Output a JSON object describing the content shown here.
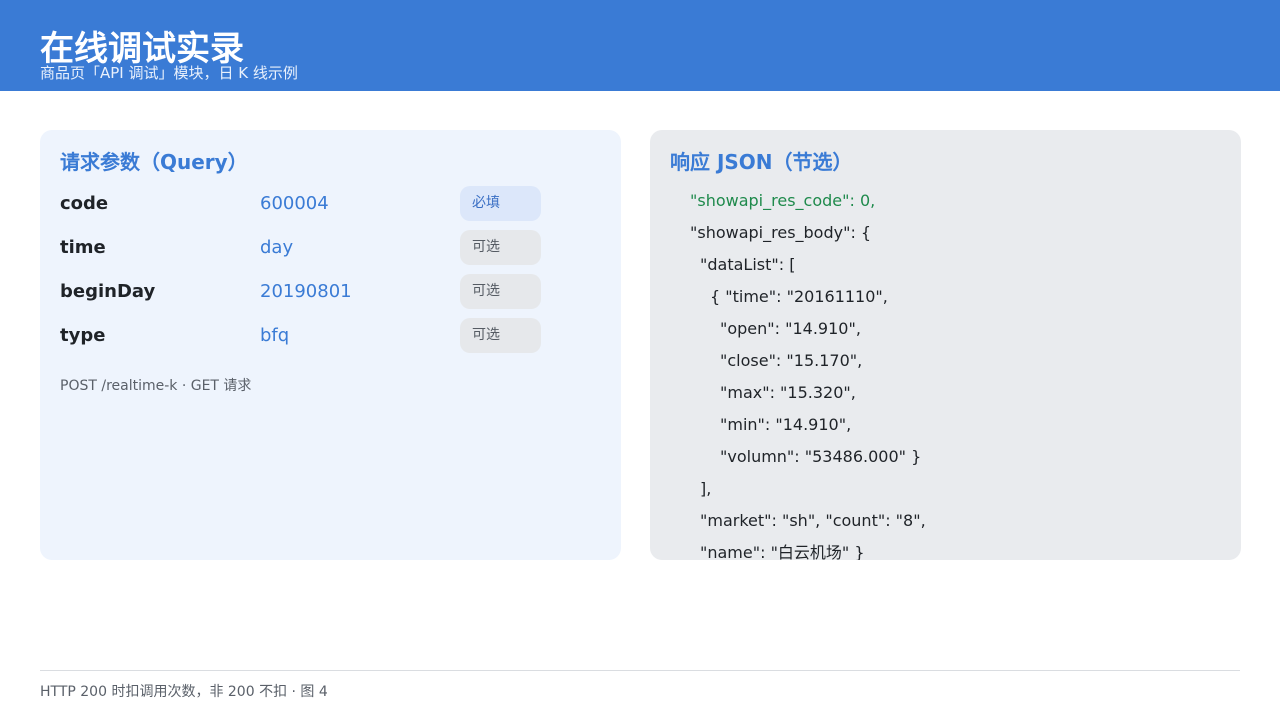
{
  "header": {
    "title": "在线调试实录",
    "subtitle": "商品页「API 调试」模块，日 K 线示例"
  },
  "request_panel": {
    "title": "请求参数（Query）",
    "params": [
      {
        "key": "code",
        "value": "600004",
        "badge": "必填",
        "required": true
      },
      {
        "key": "time",
        "value": "day",
        "badge": "可选",
        "required": false
      },
      {
        "key": "beginDay",
        "value": "20190801",
        "badge": "可选",
        "required": false
      },
      {
        "key": "type",
        "value": "bfq",
        "badge": "可选",
        "required": false
      }
    ],
    "endpoint": "POST /realtime-k · GET 请求"
  },
  "response_panel": {
    "title": "响应 JSON（节选）",
    "lines": [
      "\"showapi_res_code\": 0,",
      "\"showapi_res_body\": {",
      "\"dataList\": [",
      "{ \"time\": \"20161110\",",
      "\"open\": \"14.910\",",
      "\"close\": \"15.170\",",
      "\"max\": \"15.320\",",
      "\"min\": \"14.910\",",
      "\"volumn\": \"53486.000\" }",
      "],",
      "\"market\": \"sh\", \"count\": \"8\",",
      "\"name\": \"白云机场\" }"
    ]
  },
  "footer": {
    "note": "HTTP 200 时扣调用次数，非 200 不扣 · 图 4"
  },
  "colors": {
    "header_bg": "#3a7bd5",
    "accent": "#3a7bd5",
    "success_green": "#1f8a4c"
  }
}
